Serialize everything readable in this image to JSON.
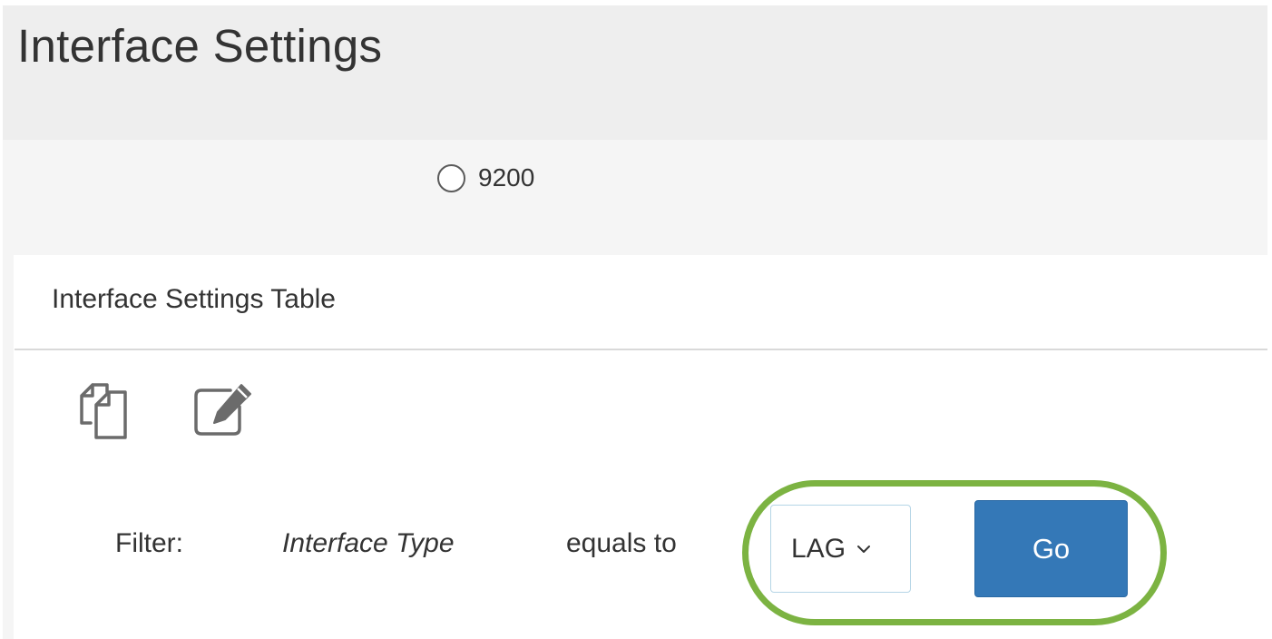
{
  "page": {
    "title": "Interface Settings"
  },
  "unit_selector": {
    "option_label": "9200",
    "selected": false
  },
  "table": {
    "title": "Interface Settings Table",
    "toolbar": {
      "copy_icon": "copy-settings-icon",
      "edit_icon": "edit-icon"
    }
  },
  "filter": {
    "label": "Filter:",
    "field": "Interface Type",
    "operator": "equals to",
    "selected_value": "LAG",
    "go_label": "Go"
  },
  "colors": {
    "header_band": "#eeeeee",
    "go_button": "#3478b7",
    "highlight_ring": "#7cb342",
    "select_border": "#b5d5e6"
  }
}
